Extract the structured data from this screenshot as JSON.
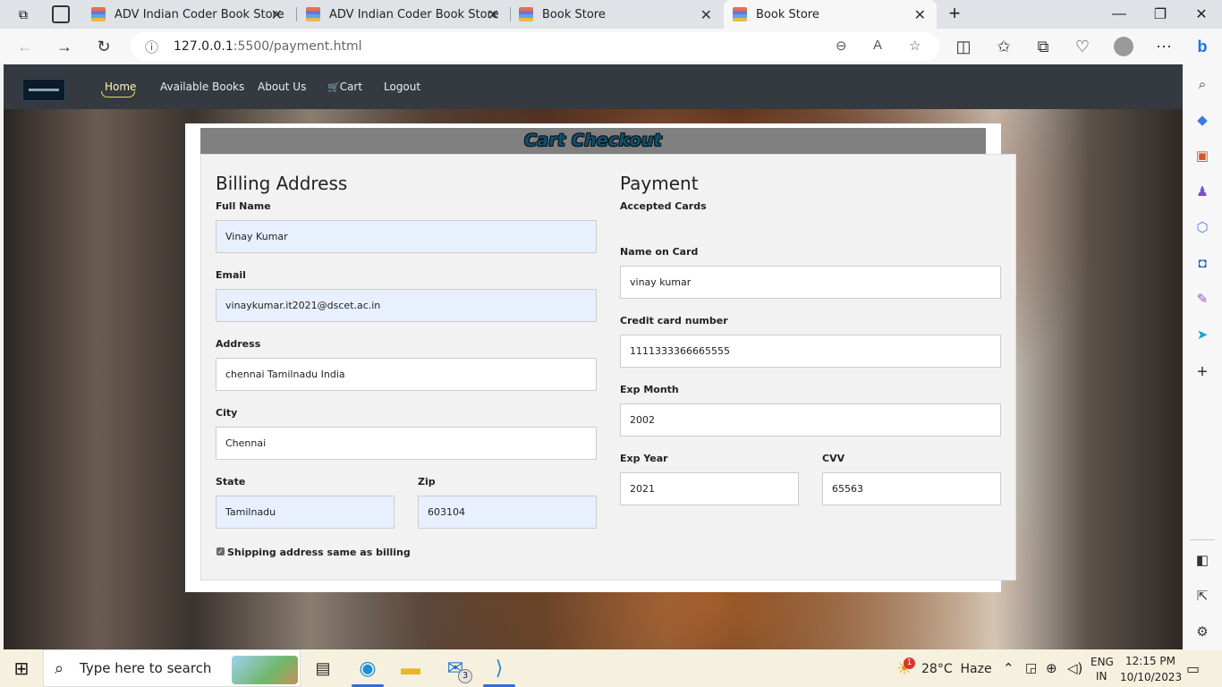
{
  "browser": {
    "tabs": [
      {
        "title": "ADV Indian Coder Book Store"
      },
      {
        "title": "ADV Indian Coder Book Store"
      },
      {
        "title": "Book Store"
      },
      {
        "title": "Book Store"
      }
    ],
    "active_tab_index": 3,
    "url_host": "127.0.0.1",
    "url_rest": ":5500/payment.html"
  },
  "site": {
    "nav": [
      "Home",
      "Available Books",
      "About Us",
      "Cart",
      "Logout"
    ],
    "active_nav": "Home",
    "title": "Cart Checkout"
  },
  "billing": {
    "heading": "Billing Address",
    "full_name_label": "Full Name",
    "full_name": "Vinay Kumar",
    "email_label": "Email",
    "email": "vinaykumar.it2021@dscet.ac.in",
    "address_label": "Address",
    "address": "chennai Tamilnadu India",
    "city_label": "City",
    "city": "Chennai",
    "state_label": "State",
    "state": "Tamilnadu",
    "zip_label": "Zip",
    "zip": "603104",
    "same_address_label": "Shipping address same as billing",
    "same_address_checked": true
  },
  "payment": {
    "heading": "Payment",
    "accepted_label": "Accepted Cards",
    "name_label": "Name on Card",
    "name": "vinay kumar",
    "card_label": "Credit card number",
    "card": "1111333366665555",
    "month_label": "Exp Month",
    "month": "2002",
    "year_label": "Exp Year",
    "year": "2021",
    "cvv_label": "CVV",
    "cvv": "65563"
  },
  "taskbar": {
    "search_placeholder": "Type here to search",
    "mail_badge": "3",
    "weather_badge": "1",
    "weather": "28°C  Haze",
    "lang_top": "ENG",
    "lang_bottom": "IN",
    "time": "12:15 PM",
    "date": "10/10/2023"
  },
  "colors": {
    "site_nav": "#343a40",
    "title_text": "#0e5070",
    "autofill": "#e8f0fe"
  }
}
